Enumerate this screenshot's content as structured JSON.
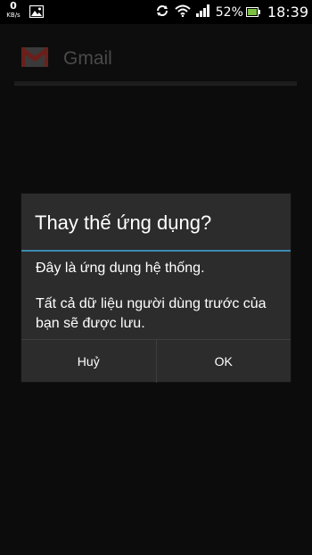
{
  "status_bar": {
    "net_speed_value": "0",
    "net_speed_unit": "KB/s",
    "battery_percent": "52%",
    "time": "18:39",
    "icons": [
      "image-notification-icon",
      "sync-icon",
      "wifi-icon",
      "signal-icon",
      "battery-icon"
    ]
  },
  "app": {
    "title": "Gmail"
  },
  "dialog": {
    "title": "Thay thế ứng dụng?",
    "message_line1": "Đây là ứng dụng hệ thống.",
    "message_line2": "Tất cả dữ liệu người dùng trước của bạn sẽ được lưu.",
    "cancel_label": "Huỷ",
    "ok_label": "OK",
    "accent_color": "#3b8bb0"
  }
}
